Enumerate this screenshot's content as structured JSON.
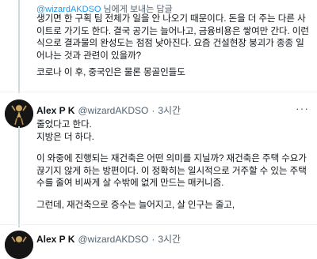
{
  "tweet1": {
    "reply_prefix": "",
    "reply_handle": "@wizardAKDSO",
    "reply_suffix": " 님에게 보내는 답글",
    "paragraph1": "생기면 한 구획 팀 전체가 일을 안 나오기 때문이다. 돈을 더 주는 다른 사이트로 가기도 한다. 결국 공기는 늘어나고, 금융비용은 쌓여만 간다. 이런 식으로 결과물의 완성도는 점점 낮아진다. 요즘 건설현장 붕괴가 종종 일어나는 것과 관련이 있을까?",
    "paragraph2": "코로나 이 후, 중국인은 물론 몽골인들도"
  },
  "tweet2": {
    "name": "Alex P K",
    "handle": "@wizardAKDSO",
    "dot": "·",
    "time": "3시간",
    "more": "···",
    "line1": "줄었다고 한다.",
    "line2": "지방은 더 하다.",
    "paragraph3": "이 와중에 진행되는 재건축은 어떤 의미를 지닐까? 재건축은 주택 수요가 끊기지 않게 하는 방편이다. 이 정확히는 일시적으로 거주할 수 있는 주택수를 줄여 비싸게 살 수밖에 없게 만드는 매커니즘.",
    "paragraph4": "그런데, 재건축으로 증수는 늘어지고, 살 인구는 줄고,"
  },
  "tweet3": {
    "name": "Alex P K",
    "handle": "@wizardAKDSO",
    "dot": "·",
    "time": "3시간"
  }
}
